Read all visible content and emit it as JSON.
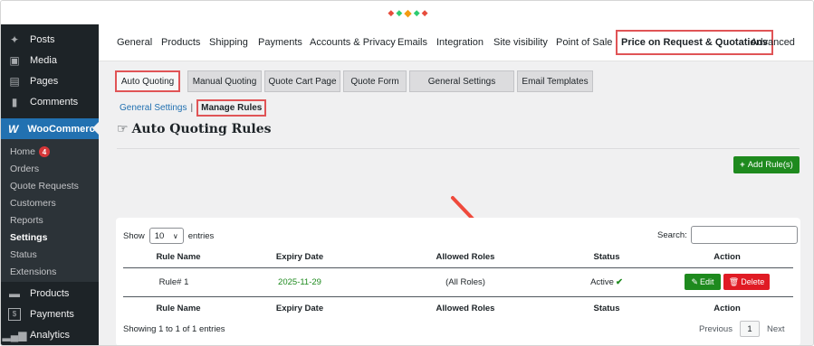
{
  "sidebar": {
    "items": [
      {
        "label": "Posts",
        "icon": "pin-icon"
      },
      {
        "label": "Media",
        "icon": "media-icon"
      },
      {
        "label": "Pages",
        "icon": "pages-icon"
      },
      {
        "label": "Comments",
        "icon": "comments-icon"
      },
      {
        "label": "WooCommerce",
        "icon": "woocommerce-icon"
      },
      {
        "label": "Products",
        "icon": "products-icon"
      },
      {
        "label": "Payments",
        "icon": "payments-icon"
      },
      {
        "label": "Analytics",
        "icon": "analytics-icon"
      }
    ],
    "submenu": [
      {
        "label": "Home",
        "badge": "4"
      },
      {
        "label": "Orders"
      },
      {
        "label": "Quote Requests"
      },
      {
        "label": "Customers"
      },
      {
        "label": "Reports"
      },
      {
        "label": "Settings"
      },
      {
        "label": "Status"
      },
      {
        "label": "Extensions"
      }
    ]
  },
  "navbar": {
    "items": [
      "General",
      "Products",
      "Shipping",
      "Payments",
      "Accounts & Privacy",
      "Emails",
      "Integration",
      "Site visibility",
      "Point of Sale",
      "Price on Request & Quotations",
      "Advanced"
    ]
  },
  "tabs": [
    "Auto Quoting",
    "Manual Quoting",
    "Quote Cart Page",
    "Quote Form",
    "General Settings",
    "Email Templates"
  ],
  "sublinks": {
    "general": "General Settings",
    "separator": "|",
    "manage": "Manage Rules"
  },
  "page_title": "Auto Quoting Rules",
  "add_button": "Add Rule(s)",
  "table": {
    "show_label": "Show",
    "entries_value": "10",
    "entries_label": "entries",
    "search_label": "Search:",
    "headers": [
      "Rule Name",
      "Expiry Date",
      "Allowed Roles",
      "Status",
      "Action"
    ],
    "rows": [
      {
        "rule": "Rule# 1",
        "expiry": "2025-11-29",
        "roles": "(All Roles)",
        "status": "Active"
      }
    ],
    "edit_label": "Edit",
    "delete_label": "Delete",
    "info": "Showing 1 to 1 of 1 entries",
    "pager": {
      "previous": "Previous",
      "page": "1",
      "next": "Next"
    }
  },
  "colors": {
    "sidebar_bg": "#1d2327",
    "active_blue": "#2271b1",
    "highlight_red": "#e05456",
    "button_green": "#1e8a1e",
    "delete_red": "#e01b24",
    "annotation_arrow": "#ef4a3c"
  }
}
